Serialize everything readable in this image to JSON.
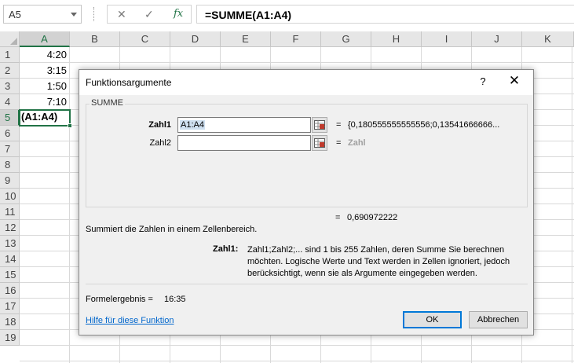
{
  "formula_bar": {
    "name_box": "A5",
    "cancel_glyph": "✕",
    "enter_glyph": "✓",
    "fx_label": "fx",
    "formula": "=SUMME(A1:A4)"
  },
  "columns": [
    "A",
    "B",
    "C",
    "D",
    "E",
    "F",
    "G",
    "H",
    "I",
    "J",
    "K"
  ],
  "rows": [
    "1",
    "2",
    "3",
    "4",
    "5",
    "6",
    "7",
    "8",
    "9",
    "10",
    "11",
    "12",
    "13",
    "14",
    "15",
    "16",
    "17",
    "18",
    "19"
  ],
  "cells": {
    "A1": "4:20",
    "A2": "3:15",
    "A3": "1:50",
    "A4": "7:10",
    "A5": "(A1:A4)"
  },
  "dialog": {
    "title": "Funktionsargumente",
    "help": "?",
    "close": "✕",
    "function_name": "SUMME",
    "args": [
      {
        "label": "Zahl1",
        "value": "A1:A4",
        "equals": "=",
        "result": "{0,180555555555556;0,13541666666..."
      },
      {
        "label": "Zahl2",
        "value": "",
        "equals": "=",
        "result": "Zahl"
      }
    ],
    "total_equals": "=",
    "total_result": "0,690972222",
    "description": "Summiert die Zahlen in einem Zellenbereich.",
    "arg_desc_name": "Zahl1:",
    "arg_desc_text": "Zahl1;Zahl2;... sind 1 bis 255 Zahlen, deren Summe Sie berechnen möchten. Logische Werte und Text werden in Zellen ignoriert, jedoch berücksichtigt, wenn sie als Argumente eingegeben werden.",
    "formula_result_label": "Formelergebnis =",
    "formula_result_value": "16:35",
    "help_link": "Hilfe für diese Funktion",
    "ok": "OK",
    "cancel": "Abbrechen"
  },
  "colors": {
    "excel_green": "#217346",
    "link_blue": "#0066cc",
    "ok_border": "#0078d7"
  }
}
